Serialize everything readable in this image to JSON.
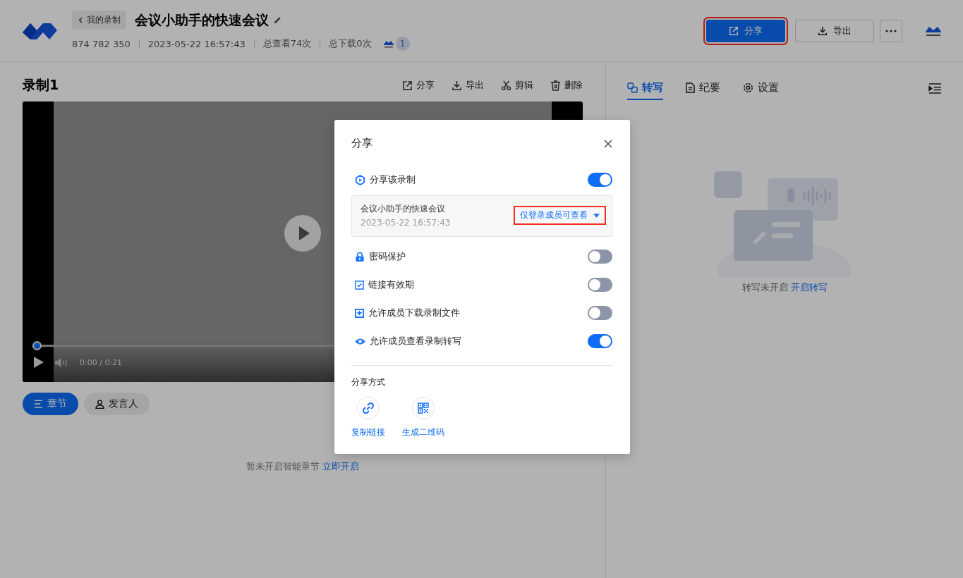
{
  "header": {
    "back": "我的录制",
    "title": "会议小助手的快速会议",
    "meeting_id": "874 782 350",
    "time": "2023-05-22 16:57:43",
    "views": "总查看74次",
    "downloads": "总下载0次",
    "participant_count": "1",
    "buttons": [
      {
        "label": "分享",
        "kind": "share"
      },
      {
        "label": "导出",
        "kind": "export"
      }
    ]
  },
  "recording": {
    "title": "录制1",
    "actions": [
      {
        "label": "分享",
        "kind": "share"
      },
      {
        "label": "导出",
        "kind": "export"
      },
      {
        "label": "剪辑",
        "kind": "cut"
      },
      {
        "label": "删除",
        "kind": "delete"
      }
    ],
    "player": {
      "level": 0,
      "time": "0:00 / 0:21"
    }
  },
  "chapter_tabs": [
    {
      "label": "章节",
      "kind": "chapters",
      "selected": true
    },
    {
      "label": "发言人",
      "kind": "speaker",
      "selected": false
    }
  ],
  "empty_chapters": {
    "text": "暂未开启智能章节",
    "link": "立即开启"
  },
  "side_panel": {
    "tabs": [
      {
        "label": "转写",
        "kind": "transcript",
        "selected": true
      },
      {
        "label": "纪要",
        "kind": "notes",
        "selected": false
      },
      {
        "label": "设置",
        "kind": "settings",
        "selected": false
      }
    ],
    "empty": {
      "text": "转写未开启",
      "link": "开启转写"
    }
  },
  "dialog": {
    "title": "分享",
    "share_toggle": {
      "label": "分享该录制",
      "on": true
    },
    "recording_card": {
      "title": "会议小助手的快速会议",
      "time": "2023-05-22 16:57:43",
      "permission": "仅登录成员可查看"
    },
    "settings": [
      {
        "kind": "lock",
        "label": "密码保护",
        "on": false
      },
      {
        "kind": "calendar",
        "label": "链接有效期",
        "on": false
      },
      {
        "kind": "download",
        "label": "允许成员下载录制文件",
        "on": false
      },
      {
        "kind": "eye",
        "label": "允许成员查看录制转写",
        "on": true
      }
    ],
    "methods_title": "分享方式",
    "methods": [
      {
        "kind": "link",
        "label": "复制链接"
      },
      {
        "kind": "qr",
        "label": "生成二维码"
      }
    ]
  }
}
